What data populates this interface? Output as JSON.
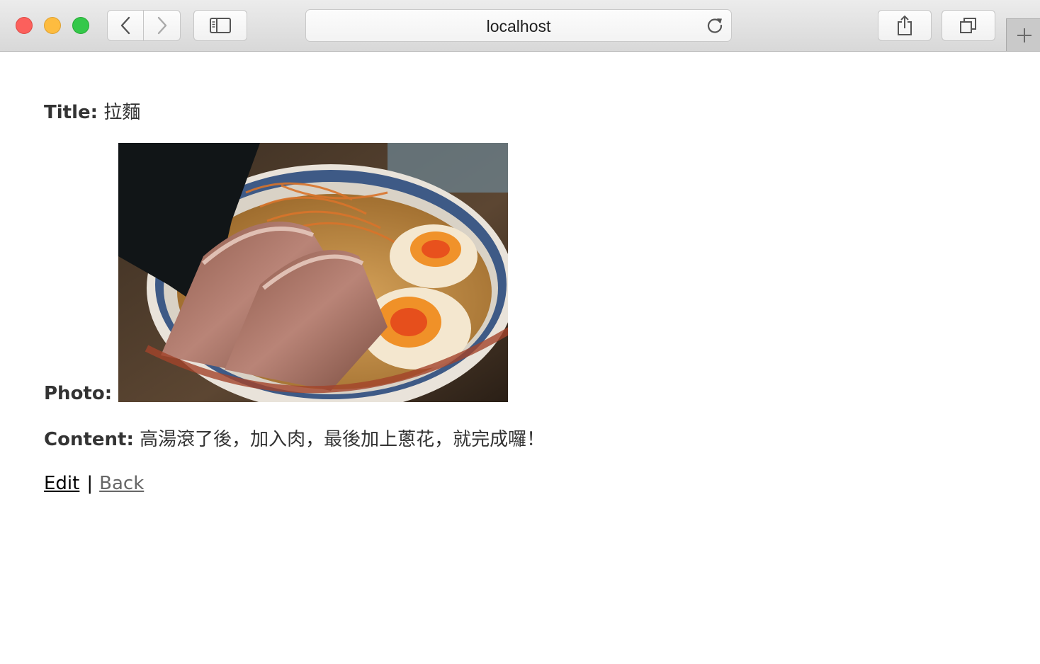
{
  "browser": {
    "url": "localhost"
  },
  "icons": {
    "back": "chevron-left-icon",
    "forward": "chevron-right-icon",
    "sidebar": "sidebar-icon",
    "reload": "reload-icon",
    "share": "share-icon",
    "tabs": "tabs-icon",
    "new_tab": "plus-icon"
  },
  "post": {
    "title_label": "Title:",
    "title_value": "拉麵",
    "photo_label": "Photo:",
    "content_label": "Content:",
    "content_value": "高湯滾了後，加入肉，最後加上蔥花，就完成囉！"
  },
  "actions": {
    "edit_label": "Edit",
    "separator": "|",
    "back_label": "Back"
  },
  "colors": {
    "text": "#333333",
    "edit_link": "#000000",
    "back_link": "#666666"
  }
}
